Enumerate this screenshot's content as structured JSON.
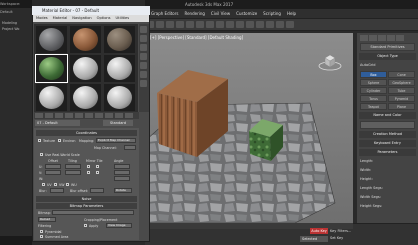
{
  "back_window": {
    "title": "Workspace: Default",
    "items": [
      "Modeling",
      "Project Wo"
    ]
  },
  "max": {
    "title": "Autodesk 3ds Max 2017",
    "menus": [
      "Graph Editors",
      "Rendering",
      "Civil View",
      "Customize",
      "Scripting",
      "Help"
    ],
    "viewport_label": "[+] [Perspective] [Standard] [Default Shading]",
    "status": {
      "auto_key": "Auto Key",
      "selected": "Selected",
      "set_key": "Set Key",
      "key_filters": "Key Filters..."
    }
  },
  "cmd_panel": {
    "section": "Standard Primitives",
    "object_type": "Object Type",
    "autogrid": "AutoGrid",
    "buttons": [
      [
        "Box",
        "Cone"
      ],
      [
        "Sphere",
        "GeoSphere"
      ],
      [
        "Cylinder",
        "Tube"
      ],
      [
        "Torus",
        "Pyramid"
      ],
      [
        "Teapot",
        "Plane"
      ]
    ],
    "name_color": "Name and Color",
    "creation_method": "Creation Method",
    "keyboard_entry": "Keyboard Entry",
    "parameters": "Parameters",
    "params": [
      "Length:",
      "Width:",
      "Height:",
      "Length Segs:",
      "Width Segs:",
      "Height Segs:"
    ]
  },
  "mat_editor": {
    "title": "Material Editor - 07 - Default",
    "menus": [
      "Modes",
      "Material",
      "Navigation",
      "Options",
      "Utilities"
    ],
    "material_name": "07 - Default",
    "material_type": "Standard",
    "rollouts": {
      "coord": "Coordinates",
      "noise": "Noise",
      "output": "Output",
      "bitmap_params": "Bitmap Parameters"
    },
    "coord_labels": {
      "texture": "Texture",
      "environ": "Environ",
      "mapping": "Mapping:",
      "mapping_value": "Explicit Map Channel",
      "map_channel": "Map Channel:",
      "use_real_world": "Use Real-World Scale",
      "offset": "Offset",
      "tiling": "Tiling",
      "mirror_tile": "Mirror Tile",
      "angle": "Angle",
      "u": "U:",
      "v": "V:",
      "w": "W:",
      "uv": "UV",
      "vw": "VW",
      "wu": "WU",
      "blur": "Blur:",
      "blur_offset": "Blur offset:",
      "rotate": "Rotate"
    },
    "bitmap": {
      "bitmap_label": "Bitmap:",
      "reload": "Reload",
      "cropping": "Cropping/Placement",
      "filtering": "Filtering",
      "pyramidal": "Pyramidal",
      "summed_area": "Summed Area",
      "none": "None",
      "apply": "Apply",
      "view_image": "View Image"
    }
  },
  "colors": {
    "max_bg": "#2a2a2a",
    "panel": "#444444",
    "accent_blue": "#2f5d9a",
    "auto_key_red": "#bb3333"
  }
}
